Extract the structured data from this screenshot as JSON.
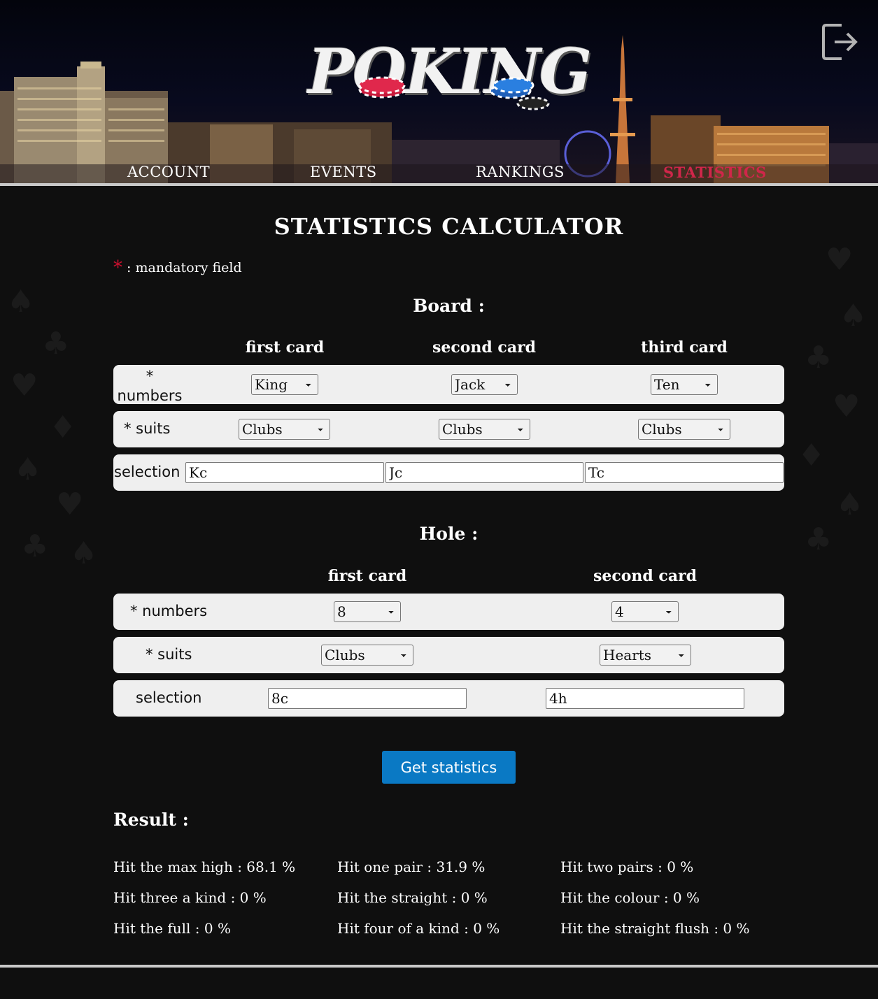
{
  "brand": {
    "logo_text": "POKING"
  },
  "nav": [
    {
      "label": "ACCOUNT",
      "active": false
    },
    {
      "label": "EVENTS",
      "active": false
    },
    {
      "label": "RANKINGS",
      "active": false
    },
    {
      "label": "STATISTICS",
      "active": true
    }
  ],
  "page_title": "STATISTICS CALCULATOR",
  "mandatory": {
    "star": "*",
    "text": ": mandatory field"
  },
  "board": {
    "title": "Board :",
    "headers": [
      "first card",
      "second card",
      "third card"
    ],
    "numbers_label": "* numbers",
    "suits_label": "* suits",
    "selection_label": "selection",
    "numbers": [
      "King",
      "Jack",
      "Ten"
    ],
    "suits": [
      "Clubs",
      "Clubs",
      "Clubs"
    ],
    "selection": [
      "Kc",
      "Jc",
      "Tc"
    ]
  },
  "hole": {
    "title": "Hole :",
    "headers": [
      "first card",
      "second card"
    ],
    "numbers_label": "* numbers",
    "suits_label": "* suits",
    "selection_label": "selection",
    "numbers": [
      "8",
      "4"
    ],
    "suits": [
      "Clubs",
      "Hearts"
    ],
    "selection": [
      "8c",
      "4h"
    ]
  },
  "get_button": "Get statistics",
  "result": {
    "title": "Result :",
    "stats": [
      "Hit the max high : 68.1 %",
      "Hit one pair : 31.9 %",
      "Hit two pairs : 0 %",
      "Hit three a kind : 0 %",
      "Hit the straight : 0 %",
      "Hit the colour : 0 %",
      "Hit the full : 0 %",
      "Hit four of a kind : 0 %",
      "Hit the straight flush : 0 %"
    ]
  },
  "colors": {
    "accent": "#d0264a",
    "button": "#0a79c4",
    "row_bg": "#efefef",
    "page_bg": "#0f0f0f"
  },
  "icons": {
    "logout": "logout-icon"
  }
}
